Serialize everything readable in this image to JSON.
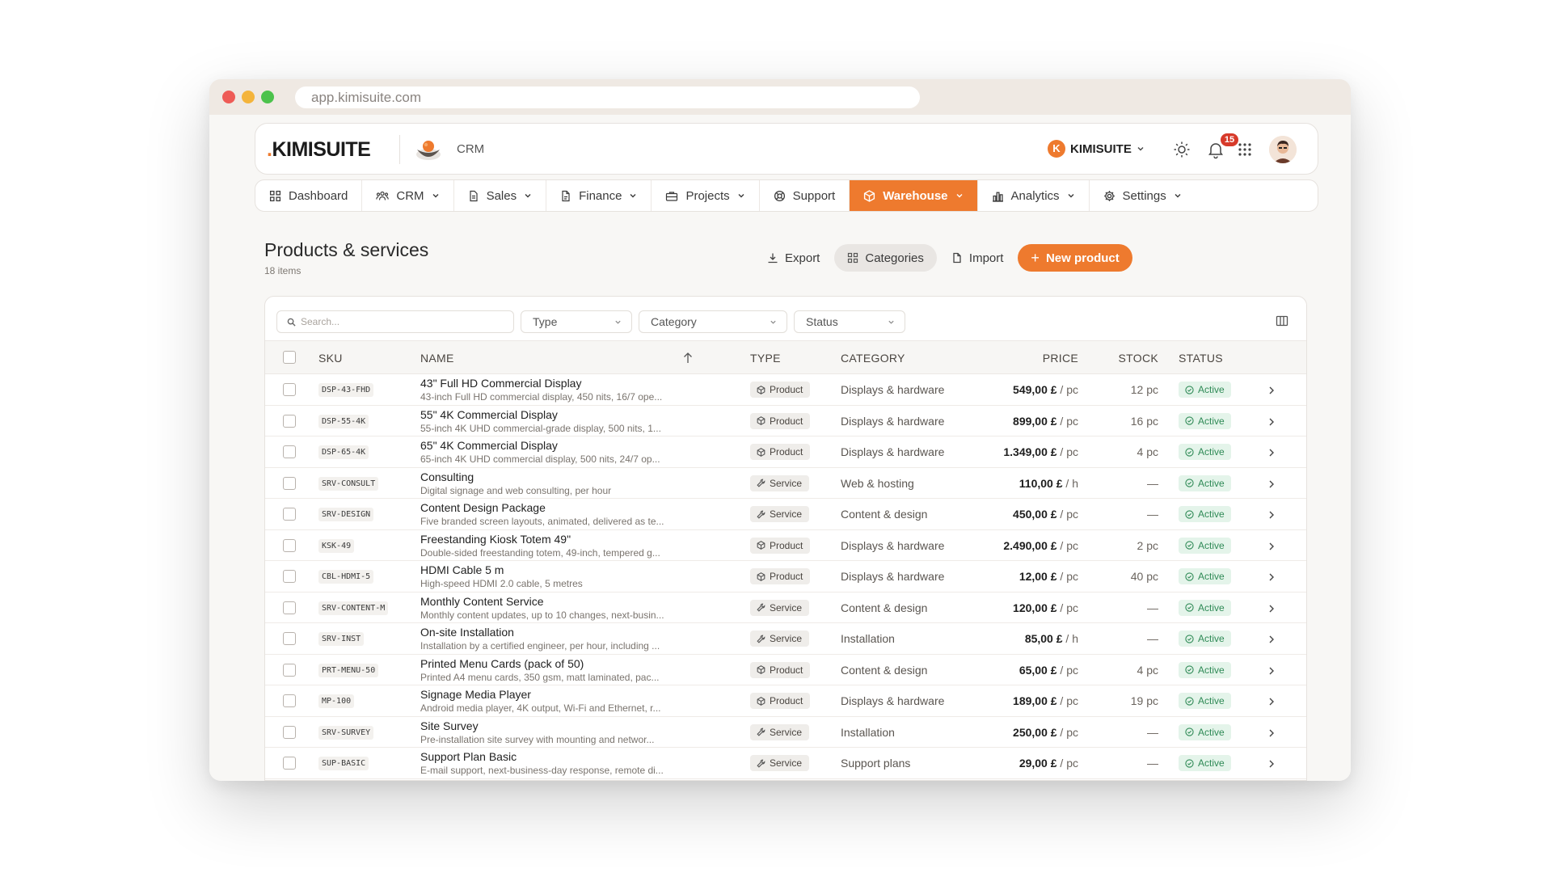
{
  "browser": {
    "url": "app.kimisuite.com"
  },
  "header": {
    "logo": "KIMISUITE",
    "module": "CRM",
    "company": "KIMISUITE",
    "company_initial": "K",
    "notifications": "15"
  },
  "nav": [
    {
      "label": "Dashboard",
      "icon": "grid-icon",
      "chevron": false,
      "active": false
    },
    {
      "label": "CRM",
      "icon": "users-icon",
      "chevron": true,
      "active": false
    },
    {
      "label": "Sales",
      "icon": "document-icon",
      "chevron": true,
      "active": false
    },
    {
      "label": "Finance",
      "icon": "invoice-icon",
      "chevron": true,
      "active": false
    },
    {
      "label": "Projects",
      "icon": "briefcase-icon",
      "chevron": true,
      "active": false
    },
    {
      "label": "Support",
      "icon": "lifebuoy-icon",
      "chevron": false,
      "active": false
    },
    {
      "label": "Warehouse",
      "icon": "box-icon",
      "chevron": true,
      "active": true
    },
    {
      "label": "Analytics",
      "icon": "bar-chart-icon",
      "chevron": true,
      "active": false
    },
    {
      "label": "Settings",
      "icon": "gear-icon",
      "chevron": true,
      "active": false
    }
  ],
  "page": {
    "title": "Products & services",
    "subtitle": "18 items"
  },
  "actions": {
    "export": "Export",
    "categories": "Categories",
    "import": "Import",
    "new_product": "New product"
  },
  "filters": {
    "search_placeholder": "Search...",
    "type": "Type",
    "category": "Category",
    "status": "Status"
  },
  "columns": {
    "sku": "SKU",
    "name": "NAME",
    "type": "TYPE",
    "category": "CATEGORY",
    "price": "PRICE",
    "stock": "STOCK",
    "status": "STATUS"
  },
  "rows": [
    {
      "sku": "DSP-43-FHD",
      "name": "43\" Full HD Commercial Display",
      "desc": "43-inch Full HD commercial display, 450 nits, 16/7 ope...",
      "type": "Product",
      "category": "Displays & hardware",
      "price": "549,00 £",
      "unit": "/ pc",
      "stock": "12 pc",
      "status": "Active"
    },
    {
      "sku": "DSP-55-4K",
      "name": "55\" 4K Commercial Display",
      "desc": "55-inch 4K UHD commercial-grade display, 500 nits, 1...",
      "type": "Product",
      "category": "Displays & hardware",
      "price": "899,00 £",
      "unit": "/ pc",
      "stock": "16 pc",
      "status": "Active"
    },
    {
      "sku": "DSP-65-4K",
      "name": "65\" 4K Commercial Display",
      "desc": "65-inch 4K UHD commercial display, 500 nits, 24/7 op...",
      "type": "Product",
      "category": "Displays & hardware",
      "price": "1.349,00 £",
      "unit": "/ pc",
      "stock": "4 pc",
      "status": "Active"
    },
    {
      "sku": "SRV-CONSULT",
      "name": "Consulting",
      "desc": "Digital signage and web consulting, per hour",
      "type": "Service",
      "category": "Web & hosting",
      "price": "110,00 £",
      "unit": "/ h",
      "stock": "—",
      "status": "Active"
    },
    {
      "sku": "SRV-DESIGN",
      "name": "Content Design Package",
      "desc": "Five branded screen layouts, animated, delivered as te...",
      "type": "Service",
      "category": "Content & design",
      "price": "450,00 £",
      "unit": "/ pc",
      "stock": "—",
      "status": "Active"
    },
    {
      "sku": "KSK-49",
      "name": "Freestanding Kiosk Totem 49\"",
      "desc": "Double-sided freestanding totem, 49-inch, tempered g...",
      "type": "Product",
      "category": "Displays & hardware",
      "price": "2.490,00 £",
      "unit": "/ pc",
      "stock": "2 pc",
      "status": "Active"
    },
    {
      "sku": "CBL-HDMI-5",
      "name": "HDMI Cable 5 m",
      "desc": "High-speed HDMI 2.0 cable, 5 metres",
      "type": "Product",
      "category": "Displays & hardware",
      "price": "12,00 £",
      "unit": "/ pc",
      "stock": "40 pc",
      "status": "Active"
    },
    {
      "sku": "SRV-CONTENT-M",
      "name": "Monthly Content Service",
      "desc": "Monthly content updates, up to 10 changes, next-busin...",
      "type": "Service",
      "category": "Content & design",
      "price": "120,00 £",
      "unit": "/ pc",
      "stock": "—",
      "status": "Active"
    },
    {
      "sku": "SRV-INST",
      "name": "On-site Installation",
      "desc": "Installation by a certified engineer, per hour, including ...",
      "type": "Service",
      "category": "Installation",
      "price": "85,00 £",
      "unit": "/ h",
      "stock": "—",
      "status": "Active"
    },
    {
      "sku": "PRT-MENU-50",
      "name": "Printed Menu Cards (pack of 50)",
      "desc": "Printed A4 menu cards, 350 gsm, matt laminated, pac...",
      "type": "Product",
      "category": "Content & design",
      "price": "65,00 £",
      "unit": "/ pc",
      "stock": "4 pc",
      "status": "Active"
    },
    {
      "sku": "MP-100",
      "name": "Signage Media Player",
      "desc": "Android media player, 4K output, Wi-Fi and Ethernet, r...",
      "type": "Product",
      "category": "Displays & hardware",
      "price": "189,00 £",
      "unit": "/ pc",
      "stock": "19 pc",
      "status": "Active"
    },
    {
      "sku": "SRV-SURVEY",
      "name": "Site Survey",
      "desc": "Pre-installation site survey with mounting and networ...",
      "type": "Service",
      "category": "Installation",
      "price": "250,00 £",
      "unit": "/ pc",
      "stock": "—",
      "status": "Active"
    },
    {
      "sku": "SUP-BASIC",
      "name": "Support Plan Basic",
      "desc": "E-mail support, next-business-day response, remote di...",
      "type": "Service",
      "category": "Support plans",
      "price": "29,00 £",
      "unit": "/ pc",
      "stock": "—",
      "status": "Active"
    }
  ],
  "colors": {
    "accent": "#ee7a2e",
    "active_bg": "#e4f4ea",
    "active_text": "#2f8a56",
    "badge": "#d73a2a"
  }
}
